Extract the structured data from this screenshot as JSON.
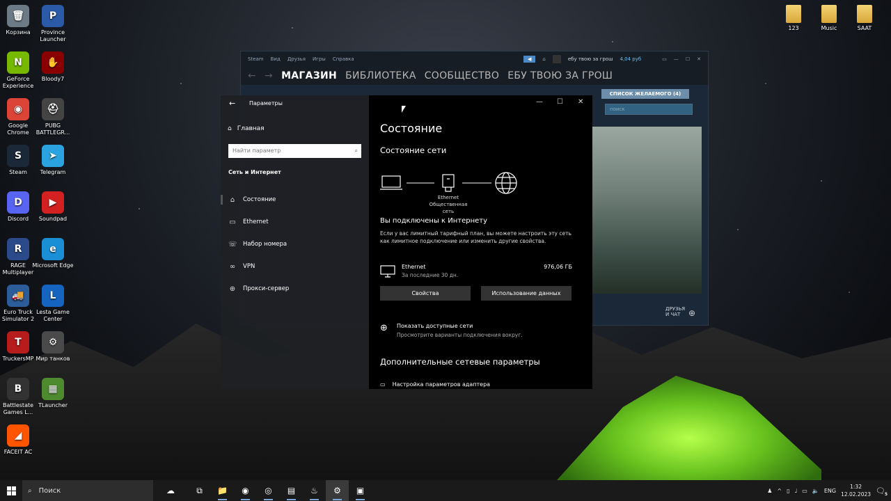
{
  "desktop_left": [
    {
      "label": "Корзина",
      "icon": "recycle-bin-icon",
      "glyph": "🗑",
      "bg": "#6c7a86"
    },
    {
      "label": "Province Launcher",
      "icon": "province-launcher-icon",
      "glyph": "P",
      "bg": "#2a5aa8"
    },
    {
      "label": "GeForce Experience",
      "icon": "geforce-icon",
      "glyph": "N",
      "bg": "#76b900"
    },
    {
      "label": "Bloody7",
      "icon": "bloody7-icon",
      "glyph": "✋",
      "bg": "#8a0000"
    },
    {
      "label": "Google Chrome",
      "icon": "chrome-icon",
      "glyph": "◉",
      "bg": "#db4437"
    },
    {
      "label": "PUBG BATTLEGR...",
      "icon": "pubg-icon",
      "glyph": "⛑",
      "bg": "#444"
    },
    {
      "label": "Steam",
      "icon": "steam-icon",
      "glyph": "S",
      "bg": "#1b2838"
    },
    {
      "label": "Telegram",
      "icon": "telegram-icon",
      "glyph": "➤",
      "bg": "#2aa3e0"
    },
    {
      "label": "Discord",
      "icon": "discord-icon",
      "glyph": "D",
      "bg": "#5865f2"
    },
    {
      "label": "Soundpad",
      "icon": "soundpad-icon",
      "glyph": "▶",
      "bg": "#d32020"
    },
    {
      "label": "RAGE Multiplayer",
      "icon": "rage-mp-icon",
      "glyph": "R",
      "bg": "#2a4a8a"
    },
    {
      "label": "Microsoft Edge",
      "icon": "edge-icon",
      "glyph": "e",
      "bg": "#1b8fd6"
    },
    {
      "label": "Euro Truck Simulator 2",
      "icon": "ets2-icon",
      "glyph": "🚚",
      "bg": "#2c5d9a"
    },
    {
      "label": "Lesta Game Center",
      "icon": "lesta-icon",
      "glyph": "L",
      "bg": "#1565c0"
    },
    {
      "label": "TruckersMP",
      "icon": "truckersmp-icon",
      "glyph": "T",
      "bg": "#b71c1c"
    },
    {
      "label": "Мир танков",
      "icon": "tanks-icon",
      "glyph": "⚙",
      "bg": "#4a4a4a"
    },
    {
      "label": "Battlestate Games L...",
      "icon": "battlestate-icon",
      "glyph": "B",
      "bg": "#333"
    },
    {
      "label": "TLauncher",
      "icon": "tlauncher-icon",
      "glyph": "▦",
      "bg": "#4e8a2e"
    },
    {
      "label": "FACEIT AC",
      "icon": "faceit-icon",
      "glyph": "◢",
      "bg": "#ff5500"
    }
  ],
  "desktop_right": [
    {
      "label": "123",
      "icon": "folder-icon"
    },
    {
      "label": "Music",
      "icon": "folder-icon"
    },
    {
      "label": "SAAT",
      "icon": "folder-icon"
    }
  ],
  "steam": {
    "menu": [
      "Steam",
      "Вид",
      "Друзья",
      "Игры",
      "Справка"
    ],
    "account": "ебу твою за грош",
    "balance": "4,04 руб",
    "nav": [
      "МАГАЗИН",
      "БИБЛИОТЕКА",
      "СООБЩЕСТВО",
      "ЕБУ ТВОЮ ЗА ГРОШ"
    ],
    "wishlist": "СПИСОК ЖЕЛАЕМОГО (4)",
    "search_placeholder": "поиск",
    "friends_line1": "ДРУЗЬЯ",
    "friends_line2": "И ЧАТ"
  },
  "settings": {
    "window_title": "Параметры",
    "home": "Главная",
    "search_placeholder": "Найти параметр",
    "category": "Сеть и Интернет",
    "nav": [
      {
        "label": "Состояние",
        "icon": "home-status-icon",
        "glyph": "⌂"
      },
      {
        "label": "Ethernet",
        "icon": "ethernet-icon",
        "glyph": "▭"
      },
      {
        "label": "Набор номера",
        "icon": "dialup-icon",
        "glyph": "☏"
      },
      {
        "label": "VPN",
        "icon": "vpn-icon",
        "glyph": "∞"
      },
      {
        "label": "Прокси-сервер",
        "icon": "globe-icon",
        "glyph": "⊕"
      }
    ],
    "page_title": "Состояние",
    "network_status_heading": "Состояние сети",
    "adapter_name": "Ethernet",
    "network_type": "Общественная сеть",
    "connected_heading": "Вы подключены к Интернету",
    "connected_desc": "Если у вас лимитный тарифный план, вы можете настроить эту сеть как лимитное подключение или изменить другие свойства.",
    "usage_name": "Ethernet",
    "usage_period": "За последние 30 дн.",
    "usage_amount": "976,06 ГБ",
    "properties_button": "Свойства",
    "data_usage_button": "Использование данных",
    "show_networks": "Показать доступные сети",
    "show_networks_desc": "Просмотрите варианты подключения вокруг.",
    "advanced_heading": "Дополнительные сетевые параметры",
    "adapter_settings": "Настройка параметров адаптера"
  },
  "taskbar": {
    "search": "Поиск",
    "apps": [
      {
        "icon": "task-view-icon",
        "glyph": "⧉"
      },
      {
        "icon": "explorer-icon",
        "glyph": "📁"
      },
      {
        "icon": "discord-icon",
        "glyph": "◉"
      },
      {
        "icon": "chrome-icon",
        "glyph": "◎"
      },
      {
        "icon": "notepad-icon",
        "glyph": "▤"
      },
      {
        "icon": "steam-icon",
        "glyph": "♨"
      },
      {
        "icon": "settings-icon",
        "glyph": "⚙"
      },
      {
        "icon": "remote-icon",
        "glyph": "▣"
      }
    ],
    "language": "ENG",
    "time": "1:32",
    "date": "12.02.2023",
    "notifications": "5"
  }
}
